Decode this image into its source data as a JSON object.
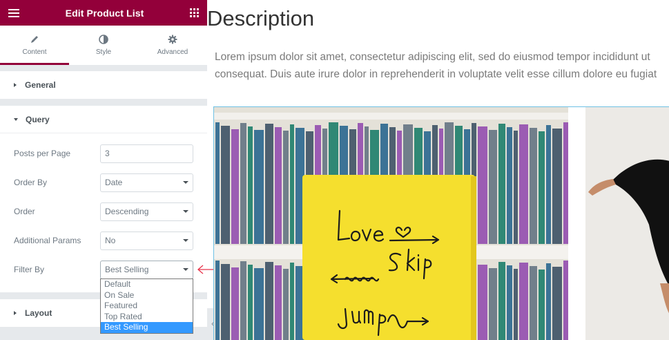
{
  "header": {
    "title": "Edit Product List",
    "menu_icon": "hamburger-icon",
    "apps_icon": "grid-icon"
  },
  "tabs": [
    {
      "label": "Content",
      "icon": "pencil-icon",
      "active": true
    },
    {
      "label": "Style",
      "icon": "half-circle-icon",
      "active": false
    },
    {
      "label": "Advanced",
      "icon": "gear-icon",
      "active": false
    }
  ],
  "sections": {
    "general": "General",
    "query": "Query",
    "layout": "Layout"
  },
  "query": {
    "posts_per_page": {
      "label": "Posts per Page",
      "value": "3"
    },
    "order_by": {
      "label": "Order By",
      "value": "Date"
    },
    "order": {
      "label": "Order",
      "value": "Descending"
    },
    "additional_params": {
      "label": "Additional Params",
      "value": "No"
    },
    "filter_by": {
      "label": "Filter By",
      "value": "Best Selling"
    }
  },
  "filter_options": [
    "Default",
    "On Sale",
    "Featured",
    "Top Rated",
    "Best Selling"
  ],
  "preview": {
    "title": "Description",
    "paragraph_line1": "Lorem ipsum dolor sit amet, consectetur adipiscing elit, sed do eiusmod tempor incididunt ut",
    "paragraph_line2": "consequat. Duis aute irure dolor in reprehenderit in voluptate velit esse cillum dolore eu fugiat",
    "book_text": [
      "Love",
      "Skip",
      "Jump"
    ]
  },
  "colors": {
    "brand": "#93003a",
    "selected_option": "#3399ff",
    "annotation_arrow": "#e8334a",
    "book": "#f5df2e"
  }
}
